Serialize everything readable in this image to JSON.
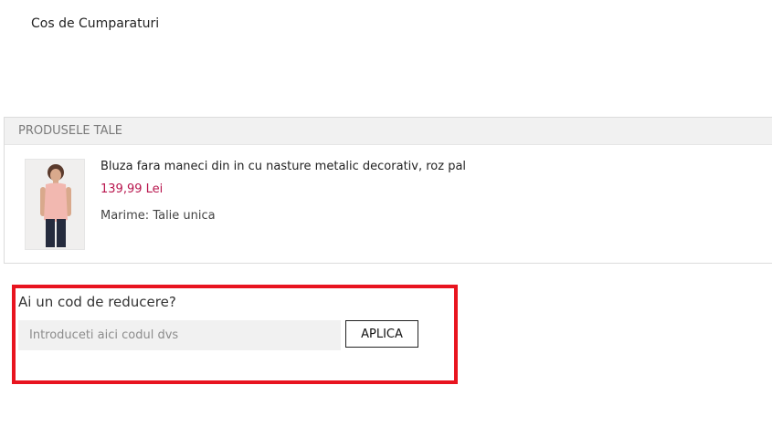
{
  "page": {
    "title": "Cos de Cumparaturi"
  },
  "products": {
    "header": "PRODUSELE TALE",
    "items": [
      {
        "name": "Bluza fara maneci din in cu nasture metalic decorativ, roz pal",
        "price": "139,99 Lei",
        "size": "Marime: Talie unica",
        "image_icon": "product-photo"
      }
    ]
  },
  "coupon": {
    "title": "Ai un cod de reducere?",
    "placeholder": "Introduceti aici codul dvs",
    "value": "",
    "button_label": "APLICA"
  },
  "colors": {
    "price": "#b8154d",
    "highlight_border": "#e8141f",
    "header_bg": "#f1f1f1"
  }
}
